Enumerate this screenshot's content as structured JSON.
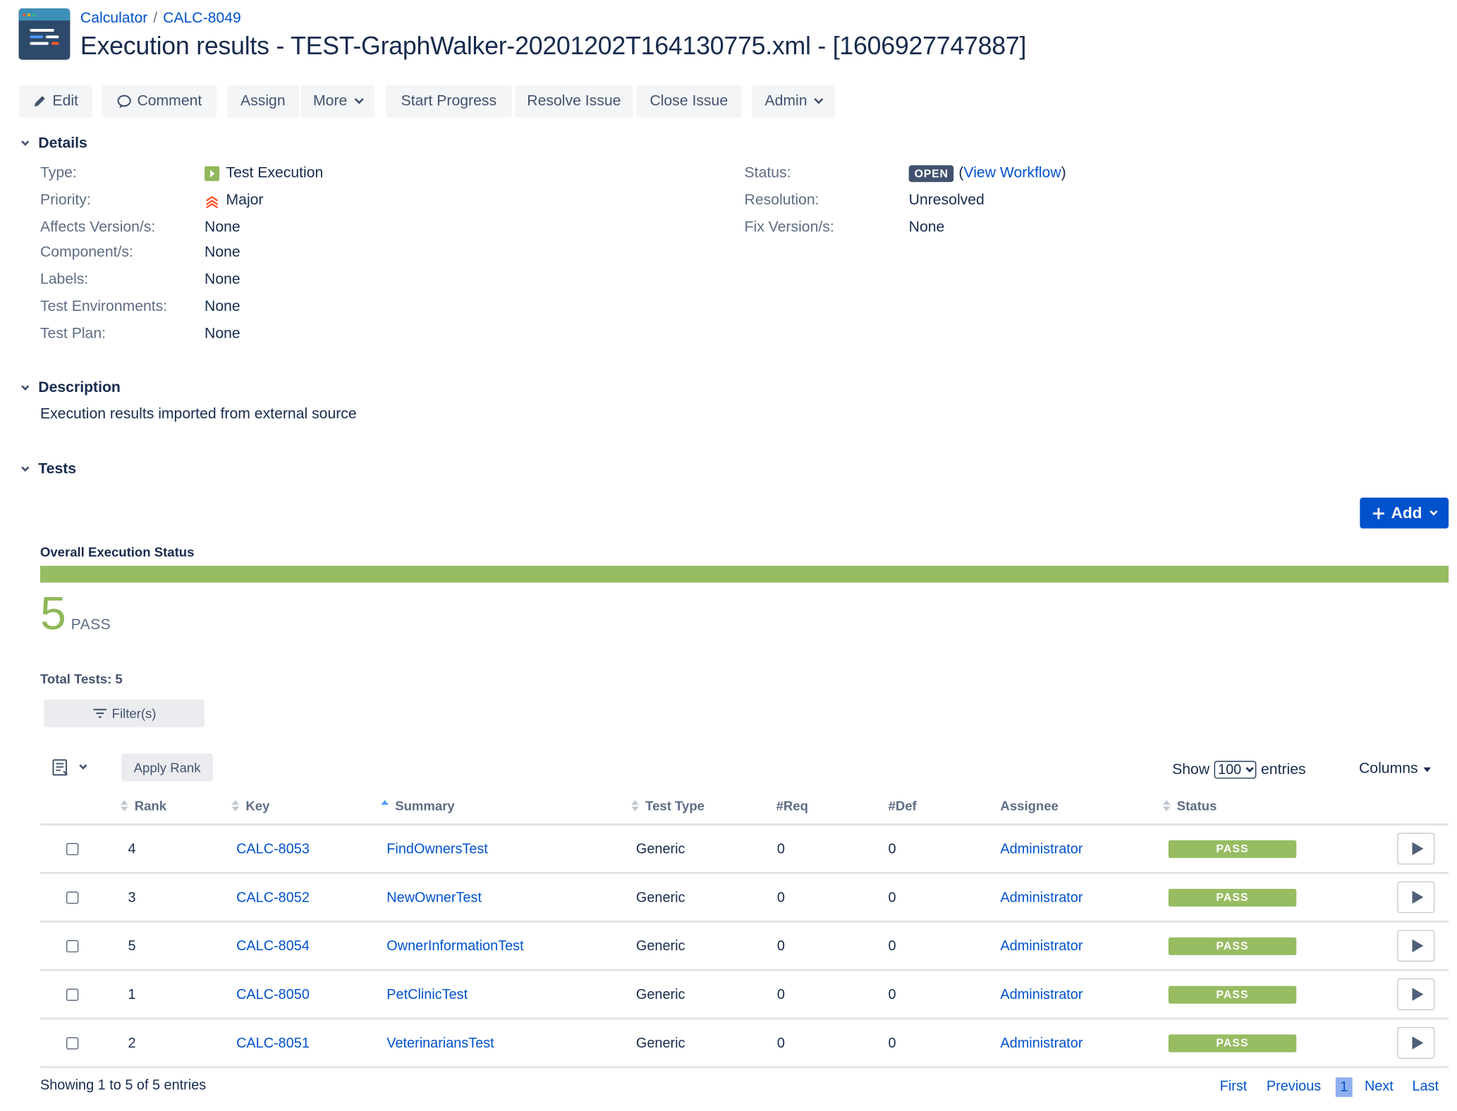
{
  "breadcrumb": {
    "project": "Calculator",
    "separator": "/",
    "issue_key": "CALC-8049"
  },
  "title": "Execution results - TEST-GraphWalker-20201202T164130775.xml - [1606927747887]",
  "toolbar": {
    "edit": "Edit",
    "comment": "Comment",
    "assign": "Assign",
    "more": "More",
    "start_progress": "Start Progress",
    "resolve_issue": "Resolve Issue",
    "close_issue": "Close Issue",
    "admin": "Admin"
  },
  "details": {
    "heading": "Details",
    "type_label": "Type:",
    "type_value": "Test Execution",
    "priority_label": "Priority:",
    "priority_value": "Major",
    "affects_label": "Affects Version/s:",
    "affects_value": "None",
    "components_label": "Component/s:",
    "components_value": "None",
    "labels_label": "Labels:",
    "labels_value": "None",
    "envs_label": "Test Environments:",
    "envs_value": "None",
    "plan_label": "Test Plan:",
    "plan_value": "None",
    "status_label": "Status:",
    "status_value": "OPEN",
    "view_workflow_open": "(",
    "view_workflow": "View Workflow",
    "view_workflow_close": ")",
    "resolution_label": "Resolution:",
    "resolution_value": "Unresolved",
    "fix_label": "Fix Version/s:",
    "fix_value": "None"
  },
  "description": {
    "heading": "Description",
    "text": "Execution results imported from external source"
  },
  "tests": {
    "heading": "Tests",
    "add_label": "Add",
    "overall_label": "Overall Execution Status",
    "pass_count": "5",
    "pass_label": "PASS",
    "pass_fraction": 1.0,
    "total_tests": "Total Tests: 5",
    "filters_label": "Filter(s)",
    "apply_rank": "Apply Rank",
    "show_label": "Show",
    "show_value": "100",
    "entries_label": "entries",
    "columns_label": "Columns",
    "headers": {
      "rank": "Rank",
      "key": "Key",
      "summary": "Summary",
      "test_type": "Test Type",
      "req": "#Req",
      "def": "#Def",
      "assignee": "Assignee",
      "status": "Status"
    },
    "rows": [
      {
        "rank": "4",
        "key": "CALC-8053",
        "summary": "FindOwnersTest",
        "test_type": "Generic",
        "req": "0",
        "def": "0",
        "assignee": "Administrator",
        "status": "PASS"
      },
      {
        "rank": "3",
        "key": "CALC-8052",
        "summary": "NewOwnerTest",
        "test_type": "Generic",
        "req": "0",
        "def": "0",
        "assignee": "Administrator",
        "status": "PASS"
      },
      {
        "rank": "5",
        "key": "CALC-8054",
        "summary": "OwnerInformationTest",
        "test_type": "Generic",
        "req": "0",
        "def": "0",
        "assignee": "Administrator",
        "status": "PASS"
      },
      {
        "rank": "1",
        "key": "CALC-8050",
        "summary": "PetClinicTest",
        "test_type": "Generic",
        "req": "0",
        "def": "0",
        "assignee": "Administrator",
        "status": "PASS"
      },
      {
        "rank": "2",
        "key": "CALC-8051",
        "summary": "VeterinariansTest",
        "test_type": "Generic",
        "req": "0",
        "def": "0",
        "assignee": "Administrator",
        "status": "PASS"
      }
    ],
    "showing": "Showing 1 to 5 of 5 entries",
    "pager": {
      "first": "First",
      "previous": "Previous",
      "current": "1",
      "next": "Next",
      "last": "Last"
    }
  },
  "colors": {
    "accent": "#0052cc",
    "pass": "#97bc62",
    "text": "#172b4d"
  },
  "icons": [
    "project-logo-icon",
    "pencil-icon",
    "comment-icon",
    "chevron-down-icon",
    "test-execution-icon",
    "priority-major-icon",
    "plus-icon",
    "filter-icon",
    "column-chooser-icon",
    "sort-icon",
    "play-icon"
  ]
}
